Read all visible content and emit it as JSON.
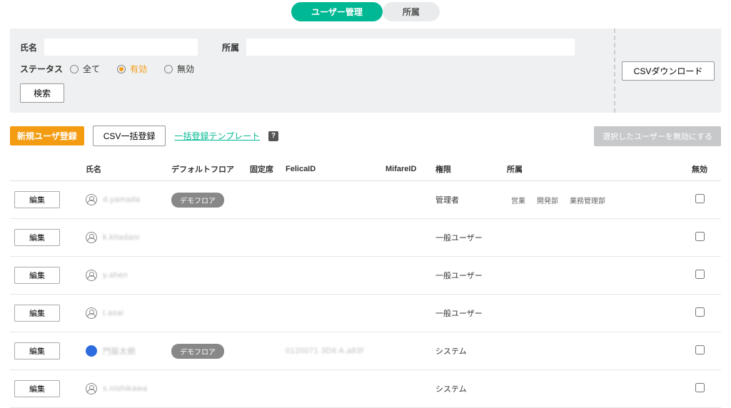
{
  "tabs": {
    "users": "ユーザー管理",
    "departments": "所属"
  },
  "filter": {
    "name_label": "氏名",
    "dept_label": "所属",
    "status_label": "ステータス",
    "status_all": "全て",
    "status_active": "有効",
    "status_inactive": "無効",
    "search": "検索",
    "csv_download": "CSVダウンロード"
  },
  "actions": {
    "new_user": "新規ユーザ登録",
    "csv_bulk": "CSV一括登録",
    "template_link": "一括登録テンプレート",
    "help": "?",
    "disable_selected": "選択したユーザーを無効にする"
  },
  "table": {
    "headers": {
      "name": "氏名",
      "floor": "デフォルトフロア",
      "seat": "固定席",
      "felica": "FelicaID",
      "mifare": "MifareID",
      "role": "権限",
      "dept": "所属",
      "disable": "無効"
    },
    "edit_label": "編集",
    "rows": [
      {
        "name": "d.yamada",
        "floor": "デモフロア",
        "seat": "",
        "felica": "",
        "mifare": "",
        "role": "管理者",
        "depts": [
          "営業",
          "開発部",
          "業務管理部"
        ],
        "avatar": "default"
      },
      {
        "name": "k.kitadani",
        "floor": "",
        "seat": "",
        "felica": "",
        "mifare": "",
        "role": "一般ユーザー",
        "depts": [],
        "avatar": "default"
      },
      {
        "name": "y.ahen",
        "floor": "",
        "seat": "",
        "felica": "",
        "mifare": "",
        "role": "一般ユーザー",
        "depts": [],
        "avatar": "default"
      },
      {
        "name": "t.asai",
        "floor": "",
        "seat": "",
        "felica": "",
        "mifare": "",
        "role": "一般ユーザー",
        "depts": [],
        "avatar": "default"
      },
      {
        "name": "門脇太朗",
        "floor": "デモフロア",
        "seat": "",
        "felica": "0120071 3D6 A.a83f",
        "mifare": "",
        "role": "システム",
        "depts": [],
        "avatar": "blue"
      },
      {
        "name": "s.nishikawa",
        "floor": "",
        "seat": "",
        "felica": "",
        "mifare": "",
        "role": "システム",
        "depts": [],
        "avatar": "default"
      }
    ]
  }
}
